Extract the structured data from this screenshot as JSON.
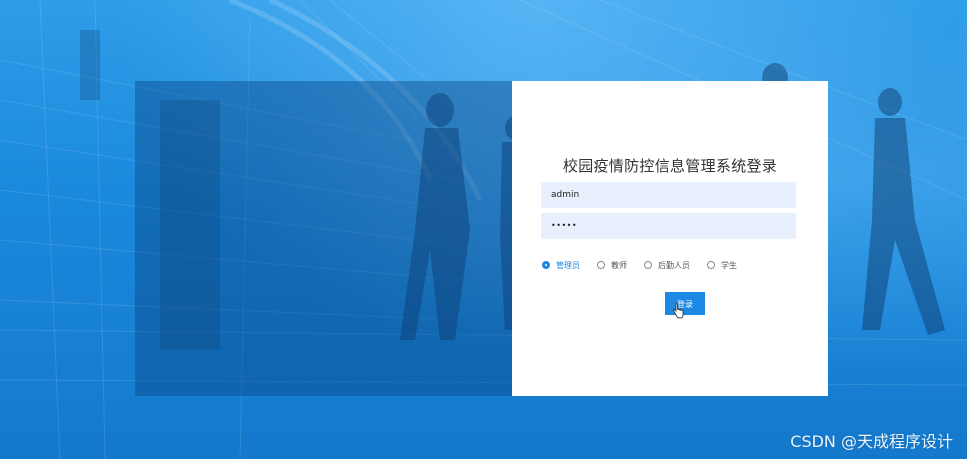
{
  "login": {
    "title": "校园疫情防控信息管理系统登录",
    "username_value": "admin",
    "password_value": "•••••",
    "roles": [
      {
        "label": "管理员",
        "checked": true
      },
      {
        "label": "教师",
        "checked": false
      },
      {
        "label": "后勤人员",
        "checked": false
      },
      {
        "label": "学生",
        "checked": false
      }
    ],
    "submit_label": "登录"
  },
  "watermark": "CSDN @天成程序设计",
  "colors": {
    "accent": "#1e88e5",
    "input_bg": "#e8f0fe",
    "background": "#1e8fe0"
  }
}
